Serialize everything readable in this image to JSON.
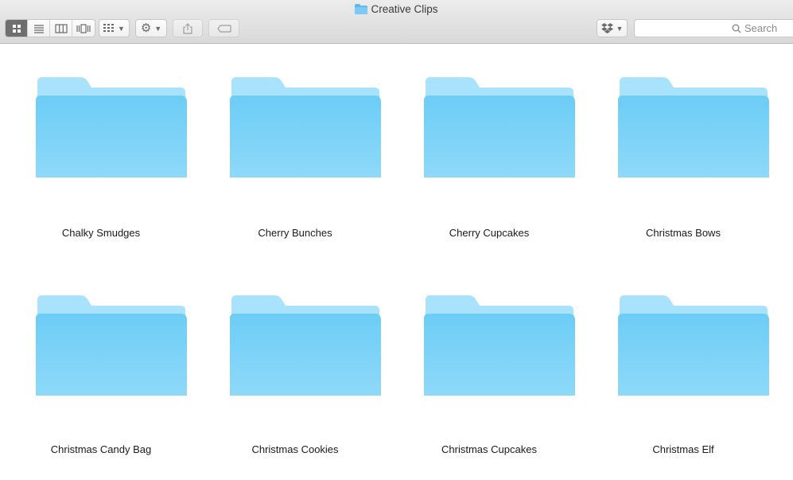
{
  "window": {
    "title": "Creative Clips"
  },
  "toolbar": {
    "view_modes": [
      "icon-view-icon",
      "list-view-icon",
      "column-view-icon",
      "cover-flow-icon"
    ],
    "active_view": "icon-view-icon",
    "search_placeholder": "Search"
  },
  "folders": [
    {
      "name": "Chalky Smudges"
    },
    {
      "name": "Cherry Bunches"
    },
    {
      "name": "Cherry Cupcakes"
    },
    {
      "name": "Christmas Bows"
    },
    {
      "name": "Christmas Candy Bag"
    },
    {
      "name": "Christmas Cookies"
    },
    {
      "name": "Christmas Cupcakes"
    },
    {
      "name": "Christmas Elf"
    }
  ],
  "colors": {
    "folder_light": "#a6e0fb",
    "folder_main": "#72cff6",
    "folder_bottom": "#9bdcf9"
  }
}
